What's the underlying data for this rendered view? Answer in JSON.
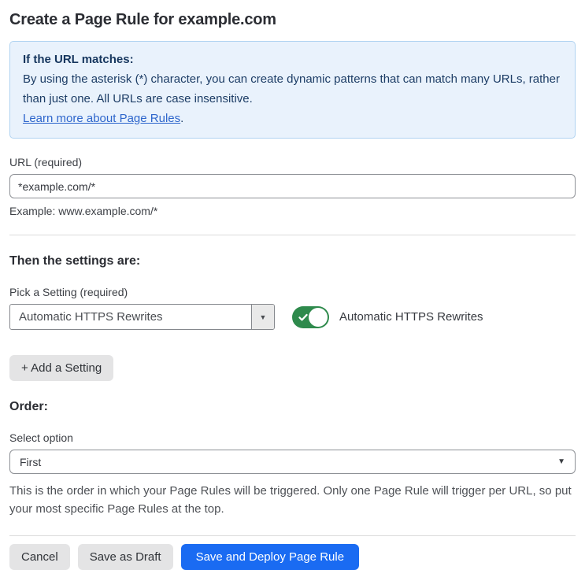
{
  "page": {
    "title": "Create a Page Rule for example.com"
  },
  "info_box": {
    "heading": "If the URL matches:",
    "body": "By using the asterisk (*) character, you can create dynamic patterns that can match many URLs, rather than just one. All URLs are case insensitive.",
    "link_label": "Learn more about Page Rules",
    "link_suffix": "."
  },
  "url_field": {
    "label": "URL (required)",
    "value": "*example.com/*",
    "helper": "Example: www.example.com/*"
  },
  "settings_section": {
    "heading": "Then the settings are:",
    "picker_label": "Pick a Setting (required)",
    "picker_value": "Automatic HTTPS Rewrites",
    "dropdown_arrow": "▼",
    "toggle_state": "on",
    "toggle_label": "Automatic HTTPS Rewrites",
    "add_setting_label": "+ Add a Setting"
  },
  "order_section": {
    "heading": "Order:",
    "select_label": "Select option",
    "select_value": "First",
    "select_arrow": "▼",
    "help_text": "This is the order in which your Page Rules will be triggered. Only one Page Rule will trigger per URL, so put your most specific Page Rules at the top."
  },
  "footer": {
    "cancel_label": "Cancel",
    "save_draft_label": "Save as Draft",
    "save_deploy_label": "Save and Deploy Page Rule"
  },
  "colors": {
    "info_bg": "#e9f2fc",
    "info_border": "#b0d3f1",
    "info_text": "#1d3d66",
    "link_blue": "#2e66cc",
    "toggle_green": "#2e8a4c",
    "primary_blue": "#1a6bf2",
    "button_gray": "#e4e4e5",
    "divider_gray": "#dadada"
  }
}
